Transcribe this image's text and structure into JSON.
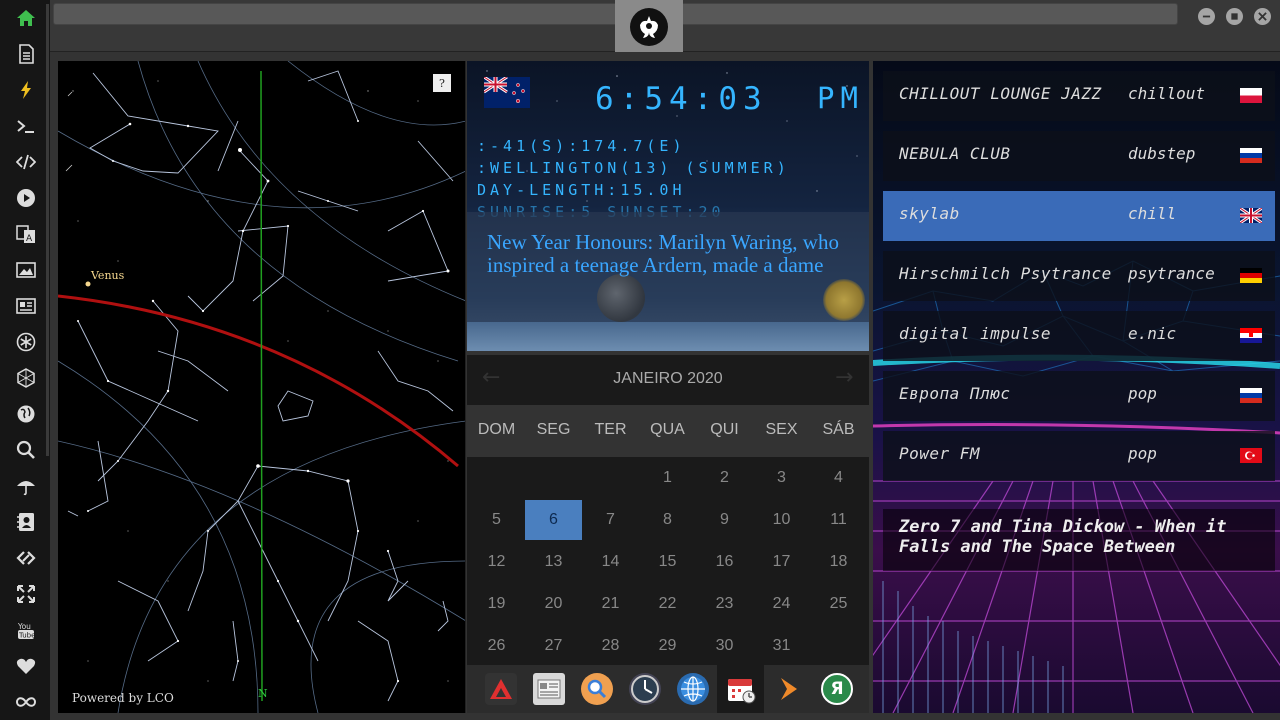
{
  "sidebar": {
    "items": [
      {
        "icon": "home-icon",
        "color": "#3fbf4f"
      },
      {
        "icon": "document-icon"
      },
      {
        "icon": "lightning-icon",
        "color": "#f0c020"
      },
      {
        "icon": "terminal-icon"
      },
      {
        "icon": "code-icon"
      },
      {
        "icon": "play-icon"
      },
      {
        "icon": "translate-icon"
      },
      {
        "icon": "image-icon"
      },
      {
        "icon": "newspaper-icon"
      },
      {
        "icon": "settings-star-icon"
      },
      {
        "icon": "hexagon-icon"
      },
      {
        "icon": "globe-icon"
      },
      {
        "icon": "search-icon"
      },
      {
        "icon": "umbrella-icon"
      },
      {
        "icon": "contact-icon"
      },
      {
        "icon": "link-icon"
      },
      {
        "icon": "expand-icon"
      },
      {
        "icon": "youtube-icon",
        "label": "You Tube"
      },
      {
        "icon": "heart-icon"
      },
      {
        "icon": "infinity-icon"
      }
    ]
  },
  "titlebar": {
    "logo": "rebel-alliance-logo",
    "buttons": [
      "minimize",
      "maximize",
      "close"
    ]
  },
  "starmap": {
    "help_label": "?",
    "powered_by": "Powered by LCO",
    "planet_label": "Venus",
    "north_label": "N",
    "ecliptic_color": "#b01010",
    "meridian_color": "#20a020"
  },
  "clock": {
    "flag": "new-zealand-flag",
    "time": "6:54:03",
    "ampm": "PM",
    "coords": ":-41(S):174.7(E)",
    "location": ":WELLINGTON(13) (SUMMER)",
    "day_length": "DAY-LENGTH:15.0H",
    "sun_times": "SUNRISE:5 SUNSET:20",
    "headline": "New Year Honours: Marilyn Waring, who inspired a teenage Ardern, made a dame",
    "digit_color": "#35b5ff"
  },
  "calendar": {
    "month_title": "JANEIRO 2020",
    "prev_label": "←",
    "next_label": "→",
    "weekdays": [
      "DOM",
      "SEG",
      "TER",
      "QUA",
      "QUI",
      "SEX",
      "SÁB"
    ],
    "weeks": [
      [
        "",
        "",
        "",
        "1",
        "2",
        "3",
        "4"
      ],
      [
        "5",
        "6",
        "7",
        "8",
        "9",
        "10",
        "11"
      ],
      [
        "12",
        "13",
        "14",
        "15",
        "16",
        "17",
        "18"
      ],
      [
        "19",
        "20",
        "21",
        "22",
        "23",
        "24",
        "25"
      ],
      [
        "26",
        "27",
        "28",
        "29",
        "30",
        "31",
        ""
      ]
    ],
    "today": "6",
    "today_color": "#4a7fbf"
  },
  "dock": {
    "apps": [
      {
        "icon": "arch-app-icon"
      },
      {
        "icon": "news-app-icon"
      },
      {
        "icon": "search-app-icon"
      },
      {
        "icon": "clock-app-icon"
      },
      {
        "icon": "globe-app-icon"
      },
      {
        "icon": "calendar-app-icon"
      },
      {
        "icon": "forward-app-icon"
      },
      {
        "icon": "yandex-app-icon",
        "label": "Я"
      }
    ]
  },
  "radio": {
    "stations": [
      {
        "name": "CHILLOUT LOUNGE JAZZ",
        "genre": "chillout",
        "flag": "poland-flag"
      },
      {
        "name": "NEBULA CLUB",
        "genre": "dubstep",
        "flag": "russia-flag"
      },
      {
        "name": "skylab",
        "genre": "chill",
        "flag": "uk-flag",
        "selected": true
      },
      {
        "name": "Hirschmilch Psytrance",
        "genre": "psytrance",
        "flag": "germany-flag"
      },
      {
        "name": "digital impulse",
        "genre": "e.nic",
        "flag": "croatia-flag"
      },
      {
        "name": "Европа Плюс",
        "genre": "pop",
        "flag": "russia-flag"
      },
      {
        "name": "Power FM",
        "genre": "pop",
        "flag": "turkey-flag"
      }
    ],
    "now_playing": "Zero 7 and Tina Dickow - When it Falls and The Space Between",
    "selected_color": "#3a6bb8"
  }
}
